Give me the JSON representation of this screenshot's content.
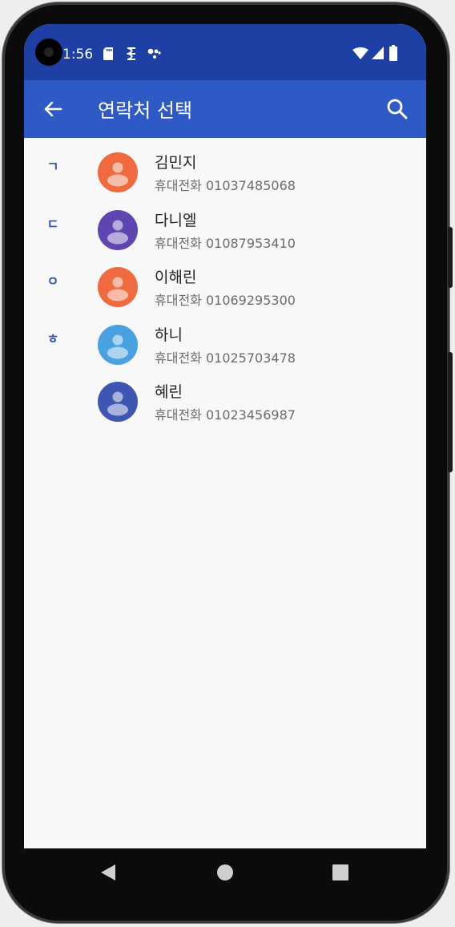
{
  "status_bar": {
    "time": "1:56",
    "icons": [
      "sd-card-icon",
      "signal-test-icon",
      "assistant-dots-icon",
      "wifi-icon",
      "cell-signal-icon",
      "battery-icon"
    ]
  },
  "app_bar": {
    "title": "연락처 선택",
    "back_icon": "arrow-back-icon",
    "search_icon": "search-icon"
  },
  "colors": {
    "status_bar": "#1e3fa4",
    "app_bar": "#2f5ac6",
    "index_letter": "#2f4fb8"
  },
  "contacts": [
    {
      "index": "ㄱ",
      "name": "김민지",
      "phone": "휴대전화 01037485068",
      "avatar_color": "#ef6a3f"
    },
    {
      "index": "ㄷ",
      "name": "다니엘",
      "phone": "휴대전화 01087953410",
      "avatar_color": "#5e45b0"
    },
    {
      "index": "ㅇ",
      "name": "이해린",
      "phone": "휴대전화 01069295300",
      "avatar_color": "#ef6a3f"
    },
    {
      "index": "ㅎ",
      "name": "하니",
      "phone": "휴대전화 01025703478",
      "avatar_color": "#4aa1e0"
    },
    {
      "index": "",
      "name": "혜린",
      "phone": "휴대전화 01023456987",
      "avatar_color": "#3f55b2"
    }
  ],
  "nav_bar": {
    "icons": [
      "nav-back-icon",
      "nav-home-icon",
      "nav-recents-icon"
    ]
  }
}
